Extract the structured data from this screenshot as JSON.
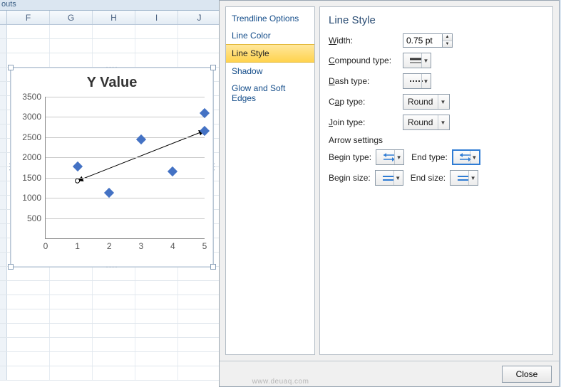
{
  "ribbon": {
    "group_label": "outs"
  },
  "columns": [
    "F",
    "G",
    "H",
    "I",
    "J"
  ],
  "chart_data": {
    "type": "scatter",
    "title": "Y Value",
    "xlabel": "",
    "ylabel": "",
    "xlim": [
      0,
      5
    ],
    "ylim": [
      0,
      3500
    ],
    "xticks": [
      0,
      1,
      2,
      3,
      4,
      5
    ],
    "yticks": [
      500,
      1000,
      1500,
      2000,
      2500,
      3000,
      3500
    ],
    "series": [
      {
        "name": "Y Value",
        "x": [
          1,
          2,
          3,
          4,
          5,
          5
        ],
        "y": [
          1780,
          1130,
          2450,
          1660,
          2660,
          3100
        ]
      }
    ],
    "trendline": {
      "type": "linear",
      "x1": 1,
      "y1": 1420,
      "x2": 5,
      "y2": 2660,
      "begin_arrow": "arrow",
      "end_arrow": "arrow"
    }
  },
  "dialog": {
    "nav": {
      "items": [
        "Trendline Options",
        "Line Color",
        "Line Style",
        "Shadow",
        "Glow and Soft Edges"
      ],
      "selected_index": 2
    },
    "panel": {
      "heading": "Line Style",
      "width_label": "Width:",
      "width_value": "0.75 pt",
      "compound_label": "Compound type:",
      "dash_label": "Dash type:",
      "cap_label": "Cap type:",
      "cap_value": "Round",
      "join_label": "Join type:",
      "join_value": "Round",
      "arrow_section": "Arrow settings",
      "begin_type_label": "Begin type:",
      "end_type_label": "End type:",
      "begin_size_label": "Begin size:",
      "end_size_label": "End size:"
    },
    "footer": {
      "close": "Close"
    }
  },
  "watermark": "www.deuaq.com"
}
